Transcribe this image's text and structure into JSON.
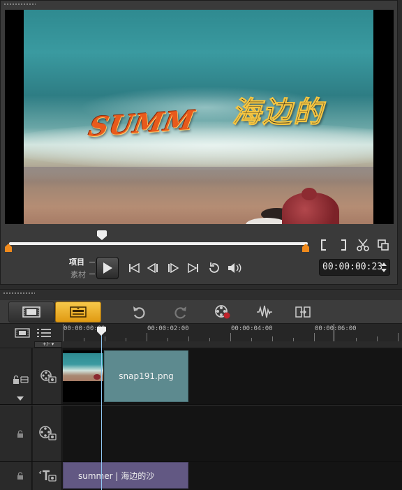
{
  "preview": {
    "overlay_title_en": "SUMM",
    "overlay_title_cn": "海边的",
    "mode_project": "项目",
    "mode_clip": "素材",
    "timecode": "00:00:00:23",
    "playhead_fraction": 0.3
  },
  "timeline": {
    "zoom_label": "+/- ▾",
    "ruler_labels": [
      "00:00:00:00",
      "00:00:02:00",
      "00:00:04:00",
      "00:00:06:00"
    ],
    "video_clip_name": "snap191.png",
    "title_clip_text": "summer | 海边的沙"
  },
  "colors": {
    "accent_orange": "#f08a1c",
    "timeline_view_active": "#f7c84a",
    "image_clip": "#5d8a8f",
    "title_clip": "#625883",
    "playhead": "#8fc7f2"
  }
}
